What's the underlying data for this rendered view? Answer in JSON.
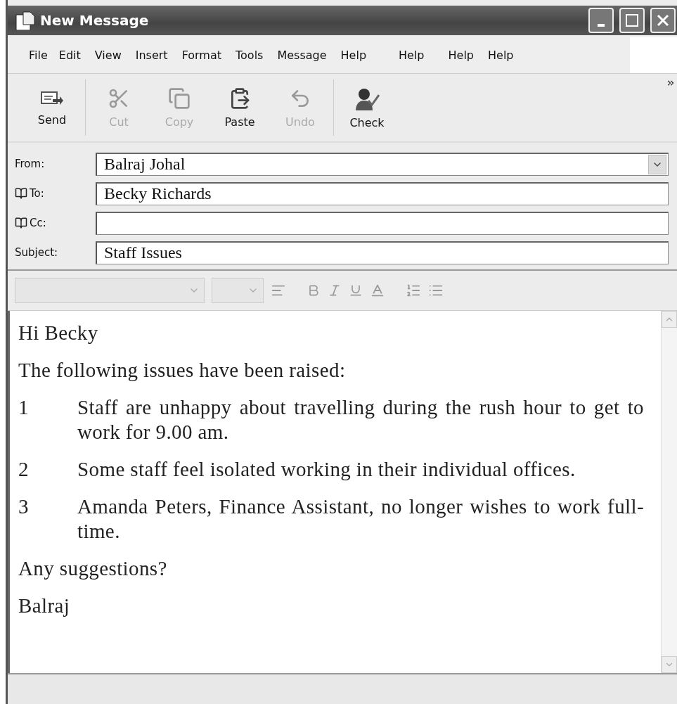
{
  "window": {
    "title": "New Message"
  },
  "menu": [
    "File",
    "Edit",
    "View",
    "Insert",
    "Format",
    "Tools",
    "Message",
    "Help",
    "Help",
    "Help",
    "Help"
  ],
  "toolbar": [
    {
      "label": "Send",
      "kind": "send",
      "disabled": false
    },
    {
      "label": "Cut",
      "kind": "cut",
      "disabled": true
    },
    {
      "label": "Copy",
      "kind": "copy",
      "disabled": true
    },
    {
      "label": "Paste",
      "kind": "paste",
      "disabled": false
    },
    {
      "label": "Undo",
      "kind": "undo",
      "disabled": true
    },
    {
      "label": "Check",
      "kind": "check",
      "disabled": false
    }
  ],
  "header_fields": [
    {
      "label": "From:",
      "value": "Balraj Johal",
      "kind": "dropdown"
    },
    {
      "label": "To:",
      "value": "Becky Richards",
      "kind": "address"
    },
    {
      "label": "Cc:",
      "kind": "address"
    },
    {
      "label": "Subject:",
      "value": "Staff Issues",
      "kind": "text"
    }
  ],
  "body": [
    {
      "kind": "paragraph",
      "text": "Hi Becky"
    },
    {
      "kind": "paragraph",
      "text": "The following issues have been raised:"
    },
    {
      "kind": "item",
      "number": "1",
      "text": "Staff are unhappy about travelling during the rush hour to get to work for 9.00 am."
    },
    {
      "kind": "item",
      "number": "2",
      "text": "Some staff feel isolated working in their individual offices."
    },
    {
      "kind": "item",
      "number": "3",
      "text": "Amanda Peters, Finance Assistant, no longer wishes to work full-time."
    },
    {
      "kind": "paragraph",
      "text": "Any suggestions?"
    },
    {
      "kind": "paragraph",
      "text": "Balraj"
    }
  ]
}
